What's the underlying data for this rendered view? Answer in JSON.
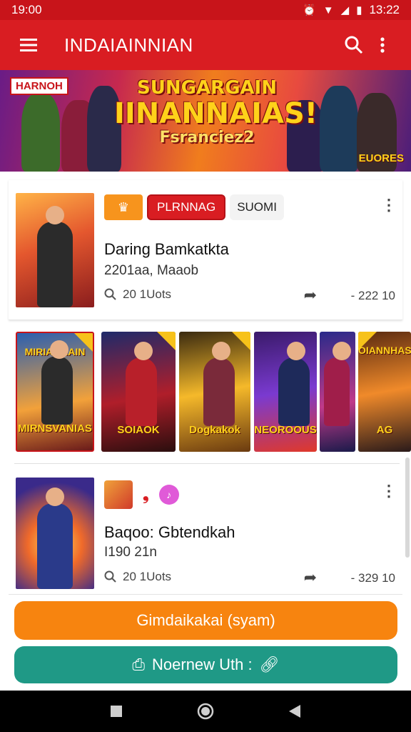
{
  "status_bar": {
    "time_left": "19:00",
    "time_right": "13:22",
    "icons": [
      "alarm-icon",
      "wifi-icon",
      "signal-icon",
      "battery-icon"
    ]
  },
  "app_bar": {
    "title": "INDAIAINNIAN",
    "menu_icon": "hamburger-icon",
    "search_icon": "search-icon",
    "overflow_icon": "more-vert-icon"
  },
  "banner": {
    "tag": "HARNOH",
    "title_line1": "SUNGARGAIN",
    "title_line2": "IINANNAIAS!",
    "title_line3": "Fsranciez2",
    "corner_text": "EUORES"
  },
  "card1": {
    "chip_red": "PLRNNAG",
    "chip_plain": "SUOMI",
    "title": "Daring Bamkatkta",
    "subtitle": "2201aa, Maaob",
    "meta": "20 1Uots",
    "count": "- 222 10"
  },
  "strip": {
    "tiles": [
      {
        "top": "MIRIAOAAIN",
        "label": "MIRNSVANIAS"
      },
      {
        "top": "",
        "label": "SOIAOK"
      },
      {
        "top": "",
        "label": "Dogkakok"
      },
      {
        "top": "",
        "label": "NEOROOUS"
      },
      {
        "top": "",
        "label": ""
      },
      {
        "top": "OIANNHAS",
        "label": "AG"
      }
    ]
  },
  "card2": {
    "title": "Baqoo: Gbtendkah",
    "subtitle": "I190 21n",
    "meta": "20 1Uots",
    "count": "- 329 10"
  },
  "buttons": {
    "orange_label": "Gimdaikakai (syam)",
    "teal_label": "Noernew Uth :"
  },
  "colors": {
    "primary": "#d91d22",
    "accent_orange": "#f7840f",
    "accent_teal": "#1f9986"
  }
}
